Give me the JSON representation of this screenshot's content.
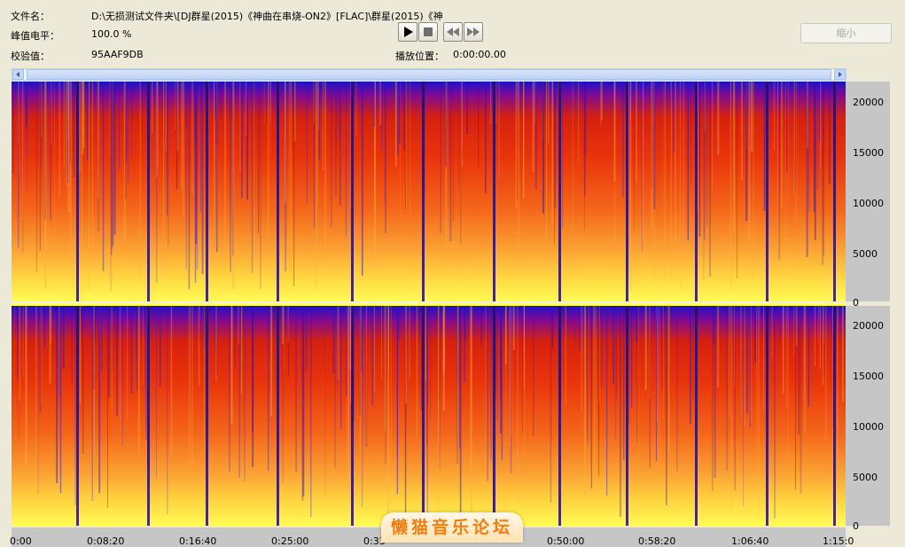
{
  "info": {
    "filename_label": "文件名：",
    "filename_value": "D:\\无损测试文件夹\\[DJ群星(2015)《神曲在串烧-ON2》[FLAC]\\群星(2015)《神",
    "peak_label": "峰值电平：",
    "peak_value": "100.0 %",
    "checksum_label": "校验值：",
    "checksum_value": "95AAF9DB",
    "position_label": "播放位置：",
    "position_value": "0:00:00.00"
  },
  "controls": {
    "play": "play-icon",
    "stop": "stop-icon",
    "rewind": "rewind-icon",
    "forward": "fast-forward-icon",
    "shrink_label": "缩小"
  },
  "spectrogram": {
    "y_ticks": [
      "20000",
      "15000",
      "10000",
      "5000",
      "0"
    ],
    "y_ticks_lower": [
      "20000",
      "15000",
      "10000",
      "5000",
      "0"
    ],
    "x_ticks": [
      "0:00",
      "0:08:20",
      "0:16:40",
      "0:25:00",
      "0:33",
      "0:50:00",
      "0:58:20",
      "1:06:40",
      "1:15:0"
    ],
    "colors": {
      "low": "#1d12c8",
      "mid": "#e9350b",
      "high": "#fffb55"
    }
  },
  "watermark": "懒猫音乐论坛"
}
